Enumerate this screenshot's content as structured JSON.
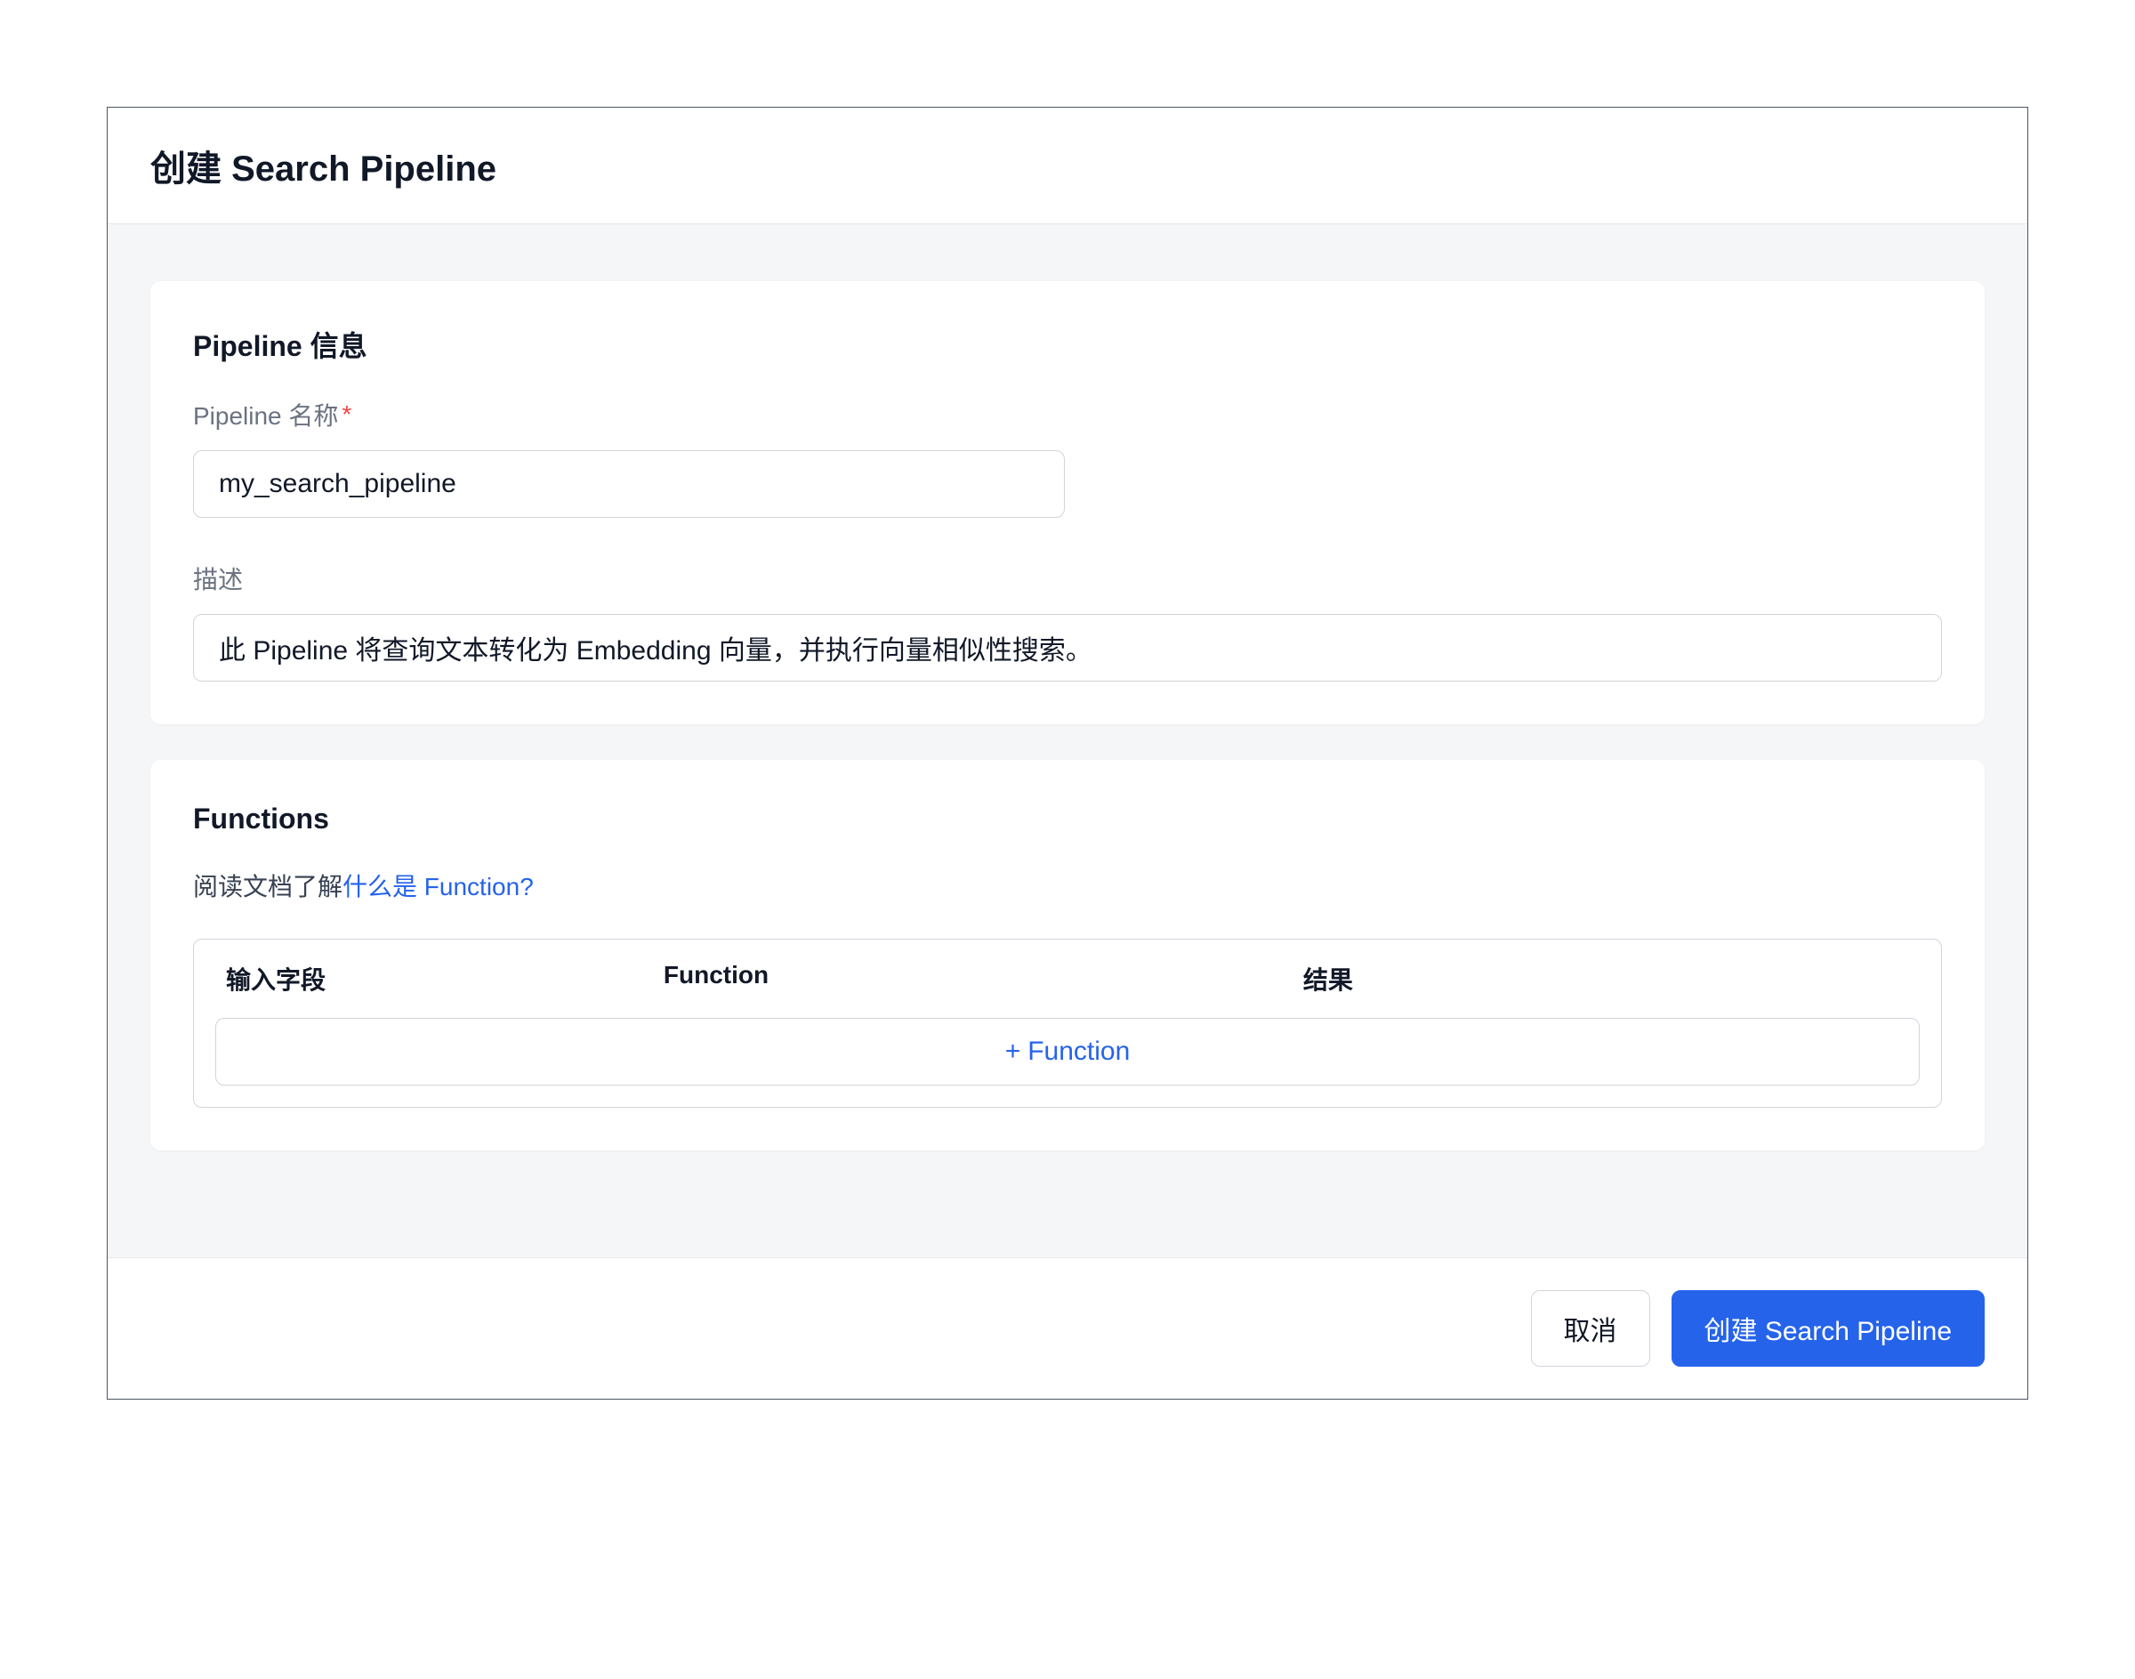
{
  "dialog": {
    "title": "创建 Search Pipeline"
  },
  "info_section": {
    "title": "Pipeline 信息",
    "name_label": "Pipeline 名称",
    "name_required_mark": "*",
    "name_value": "my_search_pipeline",
    "desc_label": "描述",
    "desc_value": "此 Pipeline 将查询文本转化为 Embedding 向量，并执行向量相似性搜索。"
  },
  "functions_section": {
    "title": "Functions",
    "help_prefix": "阅读文档了解",
    "help_link": "什么是 Function?",
    "col_input": "输入字段",
    "col_function": "Function",
    "col_result": "结果",
    "add_plus": "+",
    "add_label": "Function"
  },
  "footer": {
    "cancel": "取消",
    "create": "创建 Search Pipeline"
  }
}
